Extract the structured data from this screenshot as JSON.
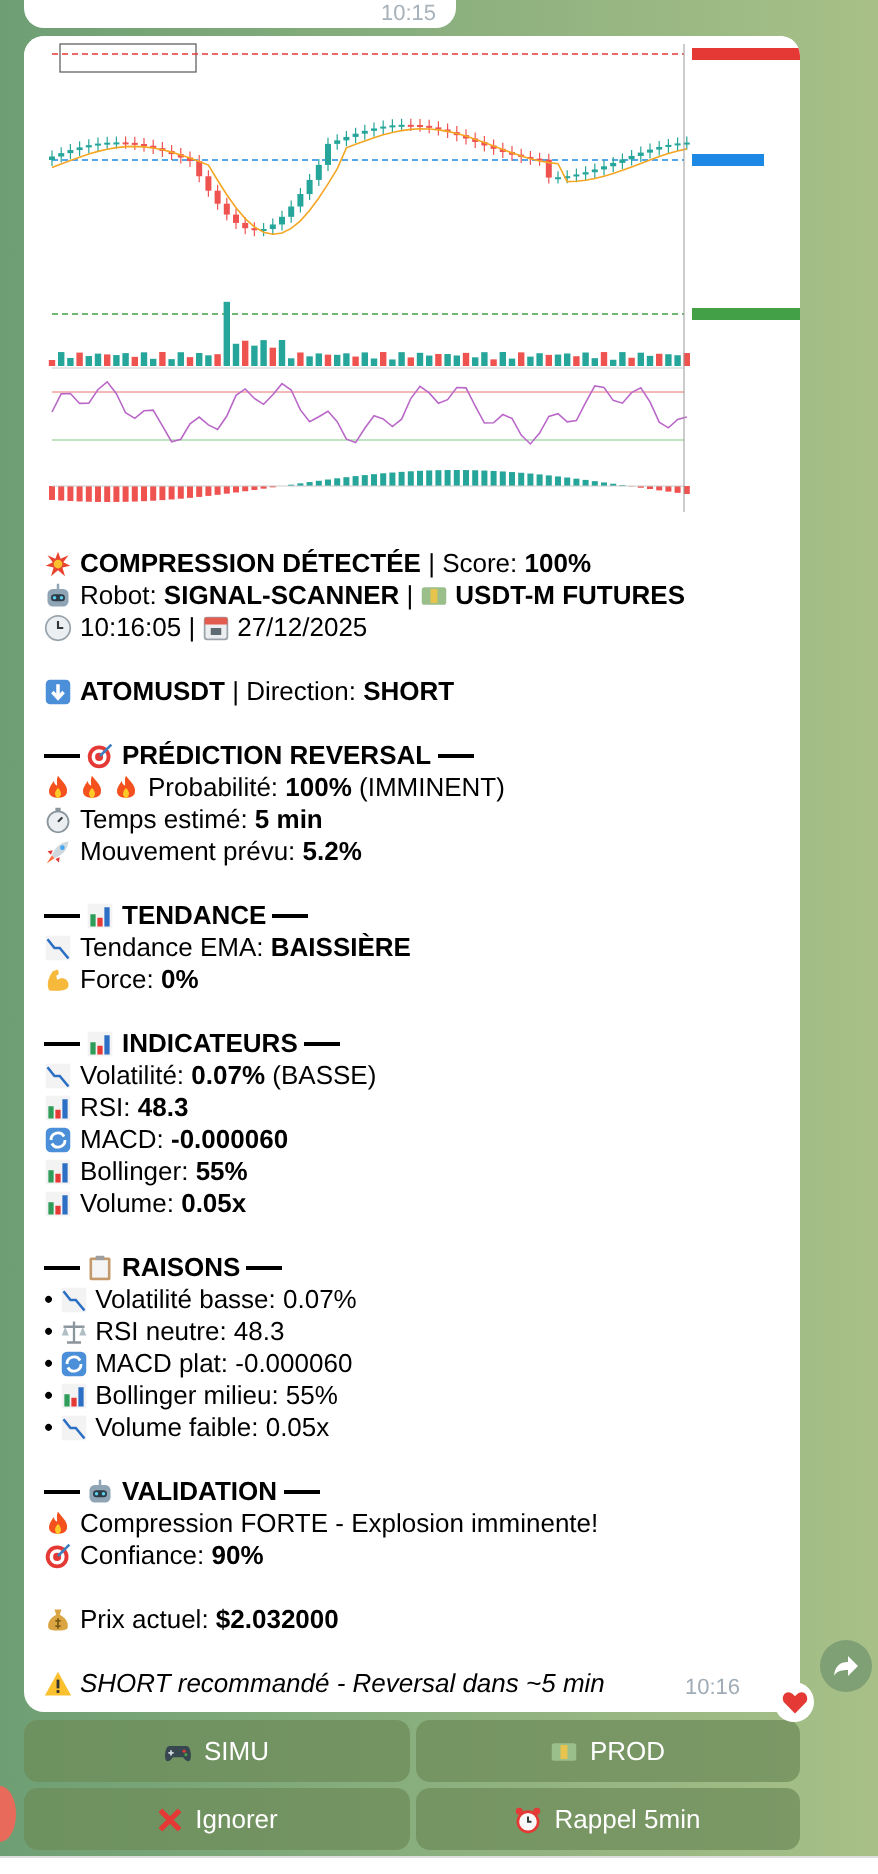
{
  "previous_message": {
    "time": "10:15"
  },
  "message": {
    "groups": [
      [
        {
          "parts": [
            {
              "kind": "explosion",
              "text": "**COMPRESSION DÉTECTÉE** | Score: **100%**"
            }
          ]
        },
        {
          "parts": [
            {
              "kind": "robot",
              "text": "Robot: **SIGNAL-SCANNER** |"
            },
            {
              "kind": "money",
              "text": "**USDT-M FUTURES**"
            }
          ]
        },
        {
          "parts": [
            {
              "kind": "clock",
              "text": "10:16:05 |"
            },
            {
              "kind": "calendar",
              "text": "27/12/2025"
            }
          ]
        }
      ],
      [
        {
          "parts": [
            {
              "kind": "arrowdown",
              "text": "**ATOMUSDT** | Direction: **SHORT**"
            }
          ]
        }
      ],
      [
        {
          "header": true,
          "parts": [
            {
              "kind": "target",
              "text": "PRÉDICTION REVERSAL"
            }
          ]
        },
        {
          "parts": [
            {
              "kind": "fire"
            },
            {
              "kind": "fire"
            },
            {
              "kind": "fire",
              "text": "Probabilité: **100%** (IMMINENT)"
            }
          ]
        },
        {
          "parts": [
            {
              "kind": "stopwatch",
              "text": "Temps estimé: **5 min**"
            }
          ]
        },
        {
          "parts": [
            {
              "kind": "rocket",
              "text": "Mouvement prévu: **5.2%**"
            }
          ]
        }
      ],
      [
        {
          "header": true,
          "parts": [
            {
              "kind": "barchart",
              "text": "TENDANCE"
            }
          ]
        },
        {
          "parts": [
            {
              "kind": "chartdown",
              "text": "Tendance EMA: **BAISSIÈRE**"
            }
          ]
        },
        {
          "parts": [
            {
              "kind": "muscle",
              "text": "Force: **0%**"
            }
          ]
        }
      ],
      [
        {
          "header": true,
          "parts": [
            {
              "kind": "barchart",
              "text": "INDICATEURS"
            }
          ]
        },
        {
          "parts": [
            {
              "kind": "chartdown",
              "text": "Volatilité: **0.07%** (BASSE)"
            }
          ]
        },
        {
          "parts": [
            {
              "kind": "barchart",
              "text": "RSI: **48.3**"
            }
          ]
        },
        {
          "parts": [
            {
              "kind": "refresh",
              "text": "MACD: **-0.000060**"
            }
          ]
        },
        {
          "parts": [
            {
              "kind": "barchart",
              "text": "Bollinger: **55%**"
            }
          ]
        },
        {
          "parts": [
            {
              "kind": "barchart",
              "text": "Volume: **0.05x**"
            }
          ]
        }
      ],
      [
        {
          "header": true,
          "parts": [
            {
              "kind": "clipboard",
              "text": "RAISONS"
            }
          ]
        },
        {
          "parts": [
            {
              "text": "•"
            },
            {
              "kind": "chartdown",
              "text": "Volatilité basse: 0.07%"
            }
          ]
        },
        {
          "parts": [
            {
              "text": "•"
            },
            {
              "kind": "scales",
              "text": "RSI neutre: 48.3"
            }
          ]
        },
        {
          "parts": [
            {
              "text": "•"
            },
            {
              "kind": "refresh",
              "text": "MACD plat: -0.000060"
            }
          ]
        },
        {
          "parts": [
            {
              "text": "•"
            },
            {
              "kind": "barchart",
              "text": "Bollinger milieu: 55%"
            }
          ]
        },
        {
          "parts": [
            {
              "text": "•"
            },
            {
              "kind": "chartdown",
              "text": "Volume faible: 0.05x"
            }
          ]
        }
      ],
      [
        {
          "header": true,
          "parts": [
            {
              "kind": "robot",
              "text": "VALIDATION"
            }
          ]
        },
        {
          "parts": [
            {
              "kind": "fire",
              "text": "Compression FORTE - Explosion imminente!"
            }
          ]
        },
        {
          "parts": [
            {
              "kind": "target",
              "text": "Confiance: **90%**"
            }
          ]
        }
      ],
      [
        {
          "parts": [
            {
              "kind": "moneybag",
              "text": "Prix actuel: **$2.032000**"
            }
          ]
        }
      ],
      [
        {
          "parts": [
            {
              "kind": "warning",
              "italic": true,
              "text": "SHORT recommandé - Reversal dans ~5 min"
            }
          ]
        }
      ]
    ],
    "time": "10:16"
  },
  "buttons": [
    {
      "kind": "gamepad",
      "label": "SIMU"
    },
    {
      "kind": "money",
      "label": "PROD"
    },
    {
      "kind": "cross",
      "label": "Ignorer"
    },
    {
      "kind": "alarm",
      "label": "Rappel 5min"
    }
  ]
}
